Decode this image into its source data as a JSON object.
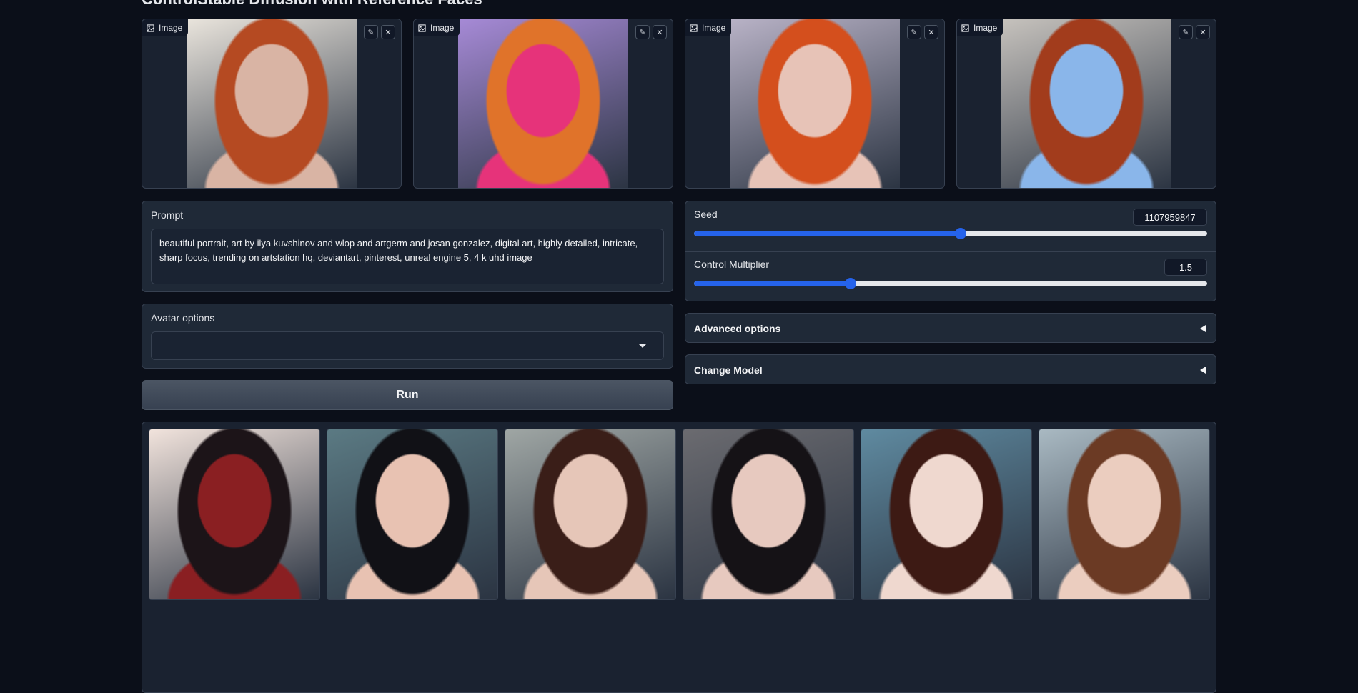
{
  "page": {
    "title": "ControlStable Diffusion with Reference Faces"
  },
  "reference_images": [
    {
      "label": "Image",
      "palette": [
        "#e9e4dc",
        "#b54a22",
        "#d9b4a4"
      ]
    },
    {
      "label": "Image",
      "palette": [
        "#a68ad6",
        "#e0732a",
        "#e6337a"
      ]
    },
    {
      "label": "Image",
      "palette": [
        "#b8b2c6",
        "#d44f1d",
        "#e7c3b7"
      ]
    },
    {
      "label": "Image",
      "palette": [
        "#c6c2bd",
        "#a23c1c",
        "#8ab6ea"
      ]
    }
  ],
  "tools": {
    "edit_glyph": "✎",
    "clear_glyph": "✕"
  },
  "prompt": {
    "label": "Prompt",
    "value": "beautiful portrait, art by ilya kuvshinov and wlop and artgerm and josan gonzalez, digital art, highly detailed, intricate, sharp focus, trending on artstation hq, deviantart, pinterest, unreal engine 5, 4 k uhd image"
  },
  "avatar_options": {
    "label": "Avatar options",
    "selected": ""
  },
  "run_button": {
    "label": "Run"
  },
  "seed": {
    "label": "Seed",
    "value": "1107959847",
    "fraction": 0.52
  },
  "control_multiplier": {
    "label": "Control Multiplier",
    "value": "1.5",
    "fraction": 0.305
  },
  "advanced_options": {
    "label": "Advanced options"
  },
  "change_model": {
    "label": "Change Model"
  },
  "gallery": [
    {
      "palette": [
        "#f1e3dc",
        "#1c1418",
        "#8a1f22"
      ]
    },
    {
      "palette": [
        "#5b7a83",
        "#111116",
        "#e8c2b2"
      ]
    },
    {
      "palette": [
        "#9fa6a4",
        "#3a1e18",
        "#e6c6b8"
      ]
    },
    {
      "palette": [
        "#6b6b70",
        "#151216",
        "#e7c9bf"
      ]
    },
    {
      "palette": [
        "#5f8aa0",
        "#3d1a14",
        "#efd8cf"
      ]
    },
    {
      "palette": [
        "#a9b9c2",
        "#6b3a24",
        "#ebcdbf"
      ]
    }
  ]
}
